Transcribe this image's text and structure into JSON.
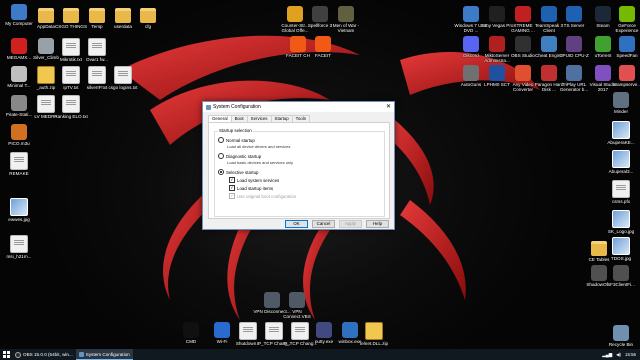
{
  "desktop": {
    "icons_left": [
      {
        "label": "My Computer",
        "type": "app",
        "color": "#3d7ac8"
      },
      {
        "label": "AppData",
        "type": "folder"
      },
      {
        "label": "CSGO THINGS",
        "type": "folder"
      },
      {
        "label": "Temp",
        "type": "folder"
      },
      {
        "label": "userdata",
        "type": "folder"
      },
      {
        "label": "cfg",
        "type": "folder"
      },
      {
        "label": "MEGAMX...",
        "type": "app",
        "color": "#d02020"
      },
      {
        "label": "Silver_Climb",
        "type": "app",
        "color": "#9aa0a8"
      },
      {
        "label": "Mikrotik.txt",
        "type": "file"
      },
      {
        "label": "Ovar1 fw...",
        "type": "file"
      },
      {
        "label": "Minimal T...",
        "type": "app",
        "color": "#c0c0c0"
      },
      {
        "label": "_auth.zip",
        "type": "zip"
      },
      {
        "label": "ipTV.txt",
        "type": "file"
      },
      {
        "label": "silverIP.txt",
        "type": "file"
      },
      {
        "label": "csgo logins.txt",
        "type": "file"
      },
      {
        "label": "Pirate-Stati...",
        "type": "app",
        "color": "#888888"
      },
      {
        "label": "LV MEDRA",
        "type": "file"
      },
      {
        "label": "Ranking ELO.txt",
        "type": "file"
      },
      {
        "label": "PICO.m3u",
        "type": "app",
        "color": "#d07020"
      },
      {
        "label": "REMAKE",
        "type": "file"
      },
      {
        "label": "ewwes.jpg",
        "type": "img"
      },
      {
        "label": "msi_h21m...",
        "type": "file"
      }
    ],
    "icons_top": [
      {
        "label": "Counter-Str... Global Offe...",
        "type": "app",
        "color": "#e0a020"
      },
      {
        "label": "Spellforce 3",
        "type": "app",
        "color": "#404040"
      },
      {
        "label": "Men of War - Vietnam",
        "type": "app",
        "color": "#606040"
      },
      {
        "label": "FACEIT CH",
        "type": "app",
        "color": "#f05a14"
      },
      {
        "label": "FACEIT",
        "type": "app",
        "color": "#f05a14"
      }
    ],
    "icons_right": [
      {
        "label": "Windows 7 USB DVD ...",
        "type": "app",
        "color": "#3d7ac8"
      },
      {
        "label": "Sony Vegas Pro",
        "type": "app",
        "color": "#202020"
      },
      {
        "label": "XTREME GAMING ...",
        "type": "app",
        "color": "#c02020"
      },
      {
        "label": "TeamSpeak 3 Client",
        "type": "app",
        "color": "#2060b0"
      },
      {
        "label": "TS Server",
        "type": "app",
        "color": "#2060b0"
      },
      {
        "label": "Steam",
        "type": "app",
        "color": "#1b2838"
      },
      {
        "label": "GeForce Experience",
        "type": "app",
        "color": "#76b900"
      },
      {
        "label": "Discord",
        "type": "app",
        "color": "#5865f2"
      },
      {
        "label": "MiktoServer Administra...",
        "type": "app",
        "color": "#b02020"
      },
      {
        "label": "OBS Studio",
        "type": "app",
        "color": "#303030"
      },
      {
        "label": "Cheat Engine",
        "type": "app",
        "color": "#4080c0"
      },
      {
        "label": "CPUID CPU-Z",
        "type": "app",
        "color": "#604080"
      },
      {
        "label": "uTorrent",
        "type": "app",
        "color": "#40a030"
      },
      {
        "label": "SpeedFan",
        "type": "app",
        "color": "#3070c0"
      },
      {
        "label": "AutoGuns",
        "type": "app",
        "color": "#707070"
      },
      {
        "label": "LPHM0 SCT",
        "type": "app",
        "color": "#2050a0"
      },
      {
        "label": "Any Video Converter",
        "type": "app",
        "color": "#e05030"
      },
      {
        "label": "Paragon Hard Disk ...",
        "type": "app",
        "color": "#c03030"
      },
      {
        "label": "TriPlay URL Generator b...",
        "type": "app",
        "color": "#5070a0"
      },
      {
        "label": "Visual Studio 2017",
        "type": "app",
        "color": "#8050c0"
      },
      {
        "label": "Wampserve...",
        "type": "app",
        "color": "#e05050"
      }
    ],
    "icons_far_right": [
      {
        "label": "Minder",
        "type": "app",
        "color": "#607080"
      },
      {
        "label": "AbuperaKE...",
        "type": "img"
      },
      {
        "label": "Abuperal3...",
        "type": "img"
      },
      {
        "label": "csrss.pfx",
        "type": "file"
      },
      {
        "label": "SK_Logo.jpg",
        "type": "img"
      },
      {
        "label": "CE Tables",
        "type": "folder"
      },
      {
        "label": "TDOS.jpg",
        "type": "img"
      },
      {
        "label": "ShadowOf...",
        "type": "app",
        "color": "#505050"
      },
      {
        "label": "SF3ClientFi...",
        "type": "app",
        "color": "#505050"
      },
      {
        "label": "Recycle Bin",
        "type": "app",
        "color": "#7090b0"
      }
    ],
    "icons_bottom_mid": [
      {
        "label": "VPN Disconnect...",
        "type": "app",
        "color": "#505a66"
      },
      {
        "label": "VPN Connect.VBS",
        "type": "app",
        "color": "#505a66"
      }
    ],
    "icons_bottom": [
      {
        "label": "CMD",
        "type": "app",
        "color": "#101010"
      },
      {
        "label": "Wi-Fi",
        "type": "app",
        "color": "#2a6ad0"
      },
      {
        "label": "Shutdown...",
        "type": "file"
      },
      {
        "label": "IP_TCP Chang...",
        "type": "file"
      },
      {
        "label": "IP_TCP Chang...",
        "type": "file"
      },
      {
        "label": "putty.exe",
        "type": "app",
        "color": "#404a80"
      },
      {
        "label": "winbox.exe",
        "type": "app",
        "color": "#3070c0"
      },
      {
        "label": "telnet.DLL.zip",
        "type": "zip"
      }
    ]
  },
  "dialog": {
    "title": "System Configuration",
    "close_glyph": "✕",
    "tabs": [
      "General",
      "Boot",
      "Services",
      "Startup",
      "Tools"
    ],
    "active_tab": "General",
    "group_title": "Startup selection",
    "options": {
      "normal": {
        "label": "Normal startup",
        "desc": "Load all device drivers and services",
        "selected": false
      },
      "diagnostic": {
        "label": "Diagnostic startup",
        "desc": "Load basic devices and services only",
        "selected": false
      },
      "selective": {
        "label": "Selective startup",
        "selected": true
      }
    },
    "checks": {
      "services": {
        "label": "Load system services",
        "checked": true
      },
      "startup": {
        "label": "Load startup items",
        "checked": true
      },
      "original_boot": {
        "label": "Use original boot configuration",
        "checked": true,
        "disabled": true
      }
    },
    "buttons": {
      "ok": "OK",
      "cancel": "Cancel",
      "apply": "Apply",
      "help": "Help"
    }
  },
  "taskbar": {
    "items": [
      {
        "label": "OBS 15.0.0 (64bit, win...",
        "icon": "obs"
      },
      {
        "label": "System Configuration",
        "icon": "msconfig",
        "active": true
      }
    ],
    "time": "15:56"
  }
}
